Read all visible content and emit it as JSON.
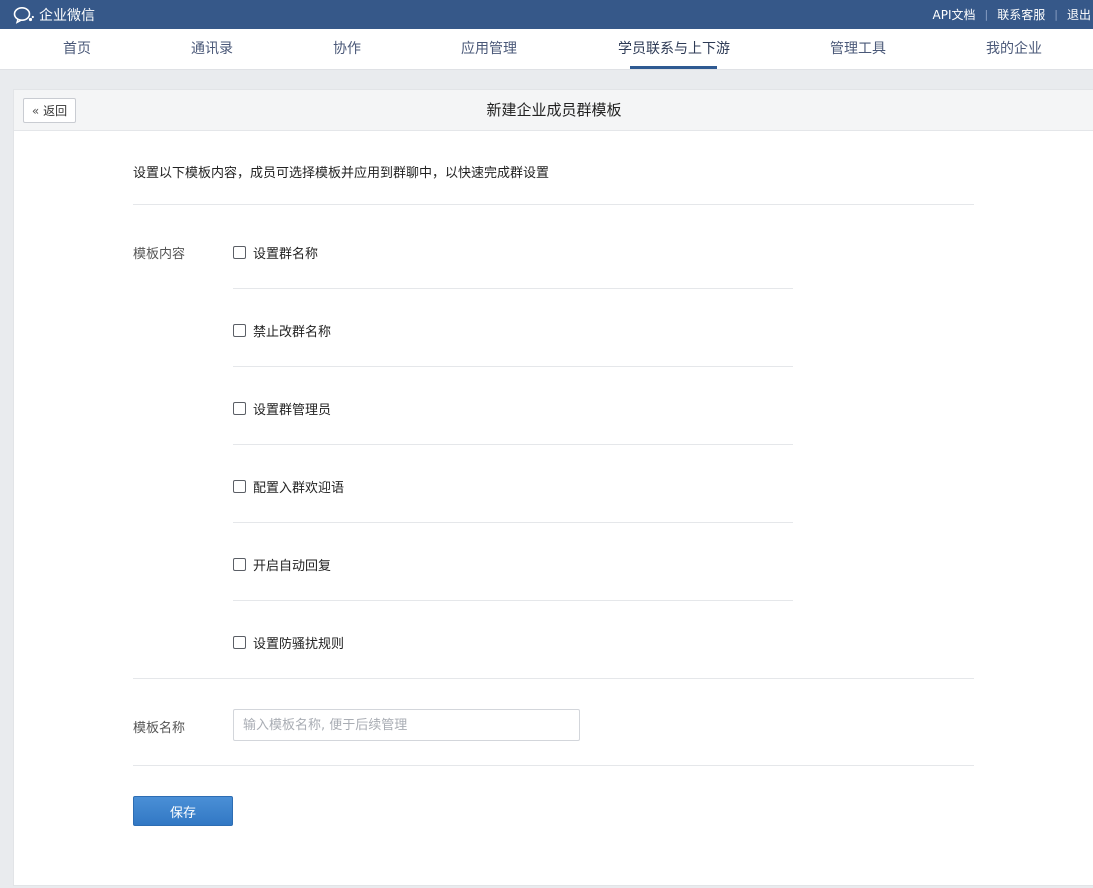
{
  "brand": {
    "name": "企业微信"
  },
  "top_links": [
    "API文档",
    "联系客服",
    "退出"
  ],
  "nav": {
    "items": [
      "首页",
      "通讯录",
      "协作",
      "应用管理",
      "学员联系与上下游",
      "管理工具",
      "我的企业"
    ],
    "active_index": 4
  },
  "page": {
    "back_label": "返回",
    "title": "新建企业成员群模板",
    "description": "设置以下模板内容，成员可选择模板并应用到群聊中，以快速完成群设置"
  },
  "template_content": {
    "label": "模板内容",
    "options": [
      {
        "label": "设置群名称",
        "checked": false
      },
      {
        "label": "禁止改群名称",
        "checked": false
      },
      {
        "label": "设置群管理员",
        "checked": false
      },
      {
        "label": "配置入群欢迎语",
        "checked": false
      },
      {
        "label": "开启自动回复",
        "checked": false
      },
      {
        "label": "设置防骚扰规则",
        "checked": false
      }
    ]
  },
  "template_name": {
    "label": "模板名称",
    "value": "",
    "placeholder": "输入模板名称, 便于后续管理"
  },
  "actions": {
    "save_label": "保存"
  },
  "colors": {
    "topbar": "#365889",
    "nav_active_underline": "#2f5a92",
    "primary_button": "#3a83cf"
  }
}
